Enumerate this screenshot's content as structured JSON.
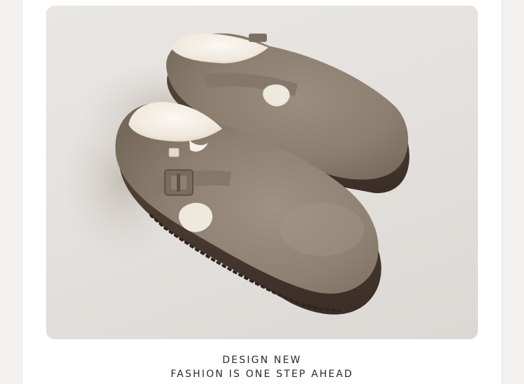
{
  "page": {
    "background": "#ffffff",
    "panel_background": "#e6e3e0"
  },
  "product": {
    "image_subject": "suede-clog-pair",
    "upper_color": "#8f8171",
    "lining_color": "#f4efe6",
    "sole_color": "#4a3b31",
    "buckle_color": "#7a6c5e"
  },
  "tagline": {
    "line1": "DESIGN NEW",
    "line2": "FASHION IS ONE STEP AHEAD"
  }
}
